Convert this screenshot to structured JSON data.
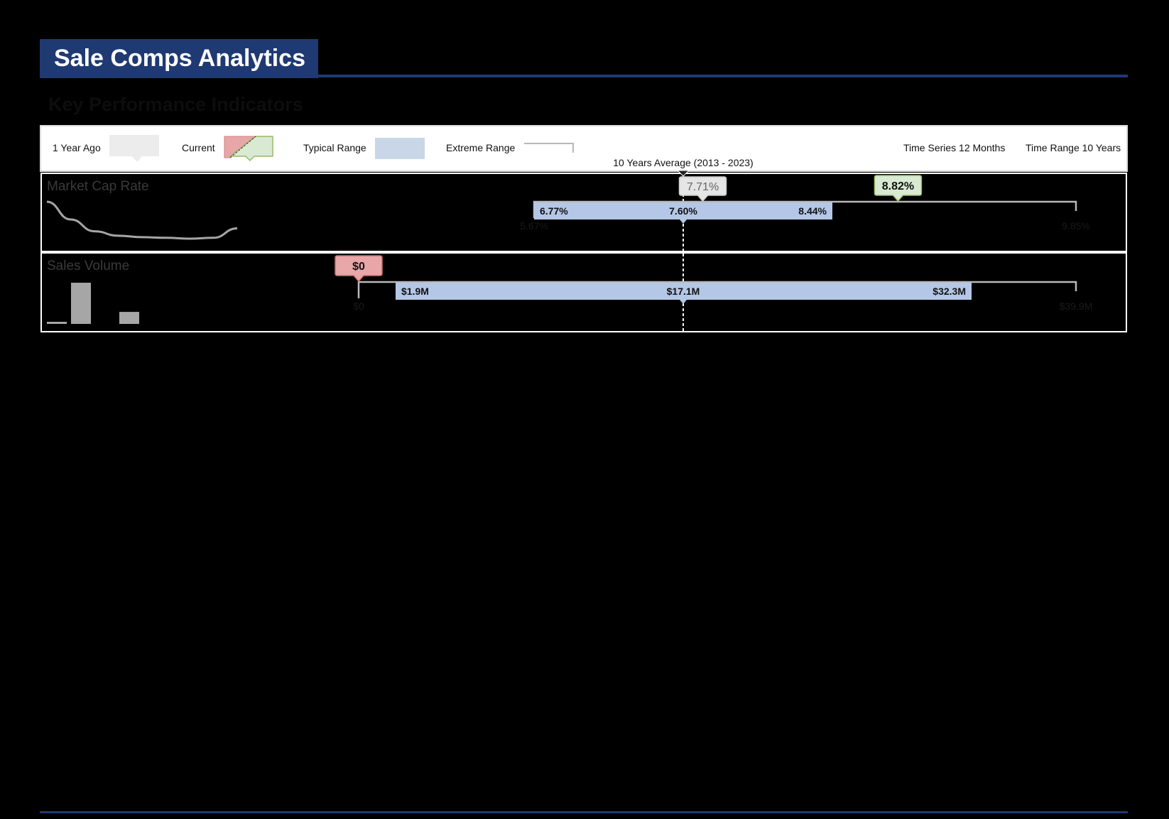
{
  "header": {
    "title": "Sale Comps Analytics",
    "section": "Key Performance Indicators"
  },
  "legend": {
    "year_ago": "1 Year Ago",
    "current": "Current",
    "typical": "Typical Range",
    "extreme": "Extreme Range",
    "time_series": "Time Series 12 Months",
    "time_range": "Time Range 10 Years"
  },
  "colors": {
    "brand": "#1f3a73",
    "typical_range": "#b4c7e7",
    "current_up": "#d9ead3",
    "current_down": "#e8a6a8",
    "year_ago": "#e5e5e5",
    "extreme_line": "#b8b8b8"
  },
  "chart_data": [
    {
      "type": "range",
      "title": "Market Cap Rate",
      "average_label": "10 Years Average (2013 - 2023)",
      "scale": [
        5.67,
        9.85
      ],
      "extreme_range": [
        6.77,
        9.85
      ],
      "extreme_labels": [
        "5.67%",
        "9.85%"
      ],
      "typical_range": [
        6.77,
        8.44
      ],
      "typical_labels": [
        "6.77%",
        "7.60%",
        "8.44%"
      ],
      "average": 7.6,
      "year_ago": {
        "value": 7.71,
        "label": "7.71%"
      },
      "current": {
        "value": 8.82,
        "label": "8.82%",
        "direction": "up"
      },
      "sparkline": {
        "type": "line",
        "values": [
          8.2,
          7.6,
          7.2,
          7.05,
          7.0,
          6.98,
          6.95,
          6.98,
          7.3
        ]
      }
    },
    {
      "type": "range",
      "title": "Sales Volume",
      "scale": [
        0,
        39.9
      ],
      "extreme_range": [
        0,
        39.9
      ],
      "extreme_labels": [
        "$0",
        "$39.9M"
      ],
      "typical_range": [
        1.9,
        32.3
      ],
      "typical_labels": [
        "$1.9M",
        "$17.1M",
        "$32.3M"
      ],
      "average": 17.1,
      "current": {
        "value": 0,
        "label": "$0",
        "direction": "down"
      },
      "sparkline": {
        "type": "bar",
        "values": [
          0.5,
          12,
          0,
          3.5
        ]
      }
    }
  ]
}
